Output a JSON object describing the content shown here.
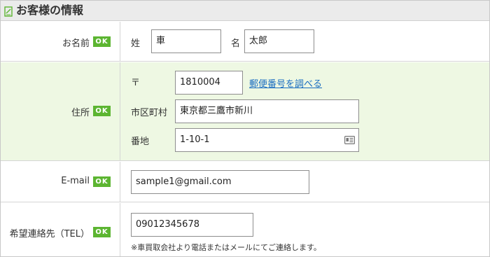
{
  "section": {
    "title": "お客様の情報"
  },
  "ok_badge": "OK",
  "rows": {
    "name": {
      "label": "お名前",
      "last_name_label": "姓",
      "last_name_value": "車",
      "first_name_label": "名",
      "first_name_value": "太郎"
    },
    "address": {
      "label": "住所",
      "postal_label": "〒",
      "postal_value": "1810004",
      "postal_lookup_link": "郵便番号を調べる",
      "city_label": "市区町村",
      "city_value": "東京都三鷹市新川",
      "street_label": "番地",
      "street_value": "1-10-1"
    },
    "email": {
      "label": "E-mail",
      "value": "sample1@gmail.com"
    },
    "tel": {
      "label": "希望連絡先（TEL）",
      "value": "09012345678",
      "note": "※車買取会社より電話またはメールにてご連絡します。"
    }
  },
  "colors": {
    "ok_badge": "#5cb531",
    "address_row_bg": "#eef8e3",
    "link": "#1a6dc1",
    "header_bg": "#ebebeb"
  },
  "icons": {
    "header": "pencil-icon",
    "street_field": "address-card-icon"
  }
}
